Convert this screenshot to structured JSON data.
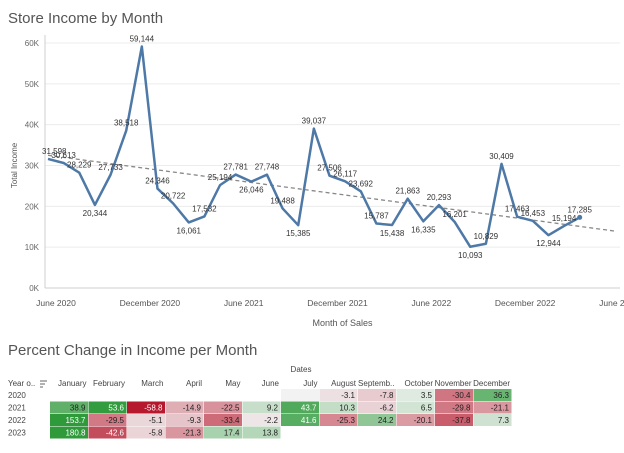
{
  "chart_data": [
    {
      "type": "line",
      "title": "Store Income by Month",
      "xlabel": "Month of Sales",
      "ylabel": "Total Income",
      "ylim": [
        0,
        60000
      ],
      "yticks": [
        "0K",
        "10K",
        "20K",
        "30K",
        "40K",
        "50K",
        "60K"
      ],
      "xticks": [
        {
          "index": 0,
          "label": "June 2020"
        },
        {
          "index": 6,
          "label": "December 2020"
        },
        {
          "index": 12,
          "label": "June 2021"
        },
        {
          "index": 18,
          "label": "December 2021"
        },
        {
          "index": 24,
          "label": "June 2022"
        },
        {
          "index": 30,
          "label": "December 2022"
        },
        {
          "index": 36,
          "label": "June 2023"
        }
      ],
      "trend_line": true,
      "trend_endpoints": [
        32500,
        13900
      ],
      "series": [
        {
          "name": "Total Income",
          "x": [
            "2020-06",
            "2020-07",
            "2020-08",
            "2020-09",
            "2020-10",
            "2020-11",
            "2020-12",
            "2021-01",
            "2021-02",
            "2021-03",
            "2021-04",
            "2021-05",
            "2021-06",
            "2021-07",
            "2021-08",
            "2021-09",
            "2021-10",
            "2021-11",
            "2021-12",
            "2022-01",
            "2022-02",
            "2022-03",
            "2022-04",
            "2022-05",
            "2022-06",
            "2022-07",
            "2022-08",
            "2022-09",
            "2022-10",
            "2022-11",
            "2022-12",
            "2023-01",
            "2023-02",
            "2023-03",
            "2023-04",
            "2023-05",
            "2023-06"
          ],
          "values": [
            31598,
            30613,
            28229,
            20344,
            27733,
            38518,
            59144,
            24346,
            20722,
            16061,
            17532,
            25194,
            27781,
            26046,
            27748,
            19488,
            15385,
            39037,
            27506,
            26117,
            23692,
            15787,
            15438,
            21863,
            16335,
            20293,
            16201,
            10093,
            10829,
            30409,
            17463,
            16453,
            12944,
            15194,
            17285,
            null,
            null
          ],
          "labels": [
            "31,598",
            "30,613",
            "28,229",
            "20,344",
            "27,733",
            "38,518",
            "59,144",
            "24,346",
            "20,722",
            "16,061",
            "17,532",
            "25,194",
            "27,781",
            "26,046",
            "27,748",
            "19,488",
            "15,385",
            "39,037",
            "27,506",
            "26,117",
            "23,692",
            "15,787",
            "15,438",
            "21,863",
            "16,335",
            "20,293",
            "16,201",
            "10,093",
            "10,829",
            "30,409",
            "17,463",
            "16,453",
            "12,944",
            "15,194",
            "17,285"
          ]
        }
      ]
    },
    {
      "type": "heatmap",
      "title": "Percent Change in Income per Month",
      "column_group_label": "Dates",
      "row_header_label": "Year o..",
      "columns": [
        "January",
        "February",
        "March",
        "April",
        "May",
        "June",
        "July",
        "August",
        "Septemb..",
        "October",
        "November",
        "December"
      ],
      "rows": [
        "2020",
        "2021",
        "2022",
        "2023"
      ],
      "values": [
        [
          null,
          null,
          null,
          null,
          null,
          null,
          0.0,
          -3.1,
          -7.8,
          3.5,
          -30.4,
          36.3
        ],
        [
          38.9,
          53.6,
          -58.8,
          -14.9,
          -22.5,
          9.2,
          43.7,
          10.3,
          -6.2,
          6.5,
          -29.8,
          -21.1
        ],
        [
          153.7,
          -29.5,
          -5.1,
          -9.3,
          -33.4,
          -2.2,
          41.6,
          -25.3,
          24.2,
          -20.1,
          -37.8,
          7.3
        ],
        [
          180.8,
          -42.6,
          -5.8,
          -21.3,
          17.4,
          13.8,
          null,
          null,
          null,
          null,
          null,
          null
        ]
      ],
      "display": [
        [
          "",
          "",
          "",
          "",
          "",
          "",
          "",
          "-3.1",
          "-7.8",
          "3.5",
          "-30.4",
          "36.3"
        ],
        [
          "38.9",
          "53.6",
          "-58.8",
          "-14.9",
          "-22.5",
          "9.2",
          "43.7",
          "10.3",
          "-6.2",
          "6.5",
          "-29.8",
          "-21.1"
        ],
        [
          "153.7",
          "-29.5",
          "-5.1",
          "-9.3",
          "-33.4",
          "-2.2",
          "41.6",
          "-25.3",
          "24.2",
          "-20.1",
          "-37.8",
          "7.3"
        ],
        [
          "180.8",
          "-42.6",
          "-5.8",
          "-21.3",
          "17.4",
          "13.8",
          "",
          "",
          "",
          "",
          "",
          ""
        ]
      ]
    }
  ],
  "colors": {
    "line": "#4e79a7",
    "trend": "#888888",
    "positive_max": "#2e9a3a",
    "negative_max": "#b5152a",
    "neutral": "#f2f2f2"
  }
}
